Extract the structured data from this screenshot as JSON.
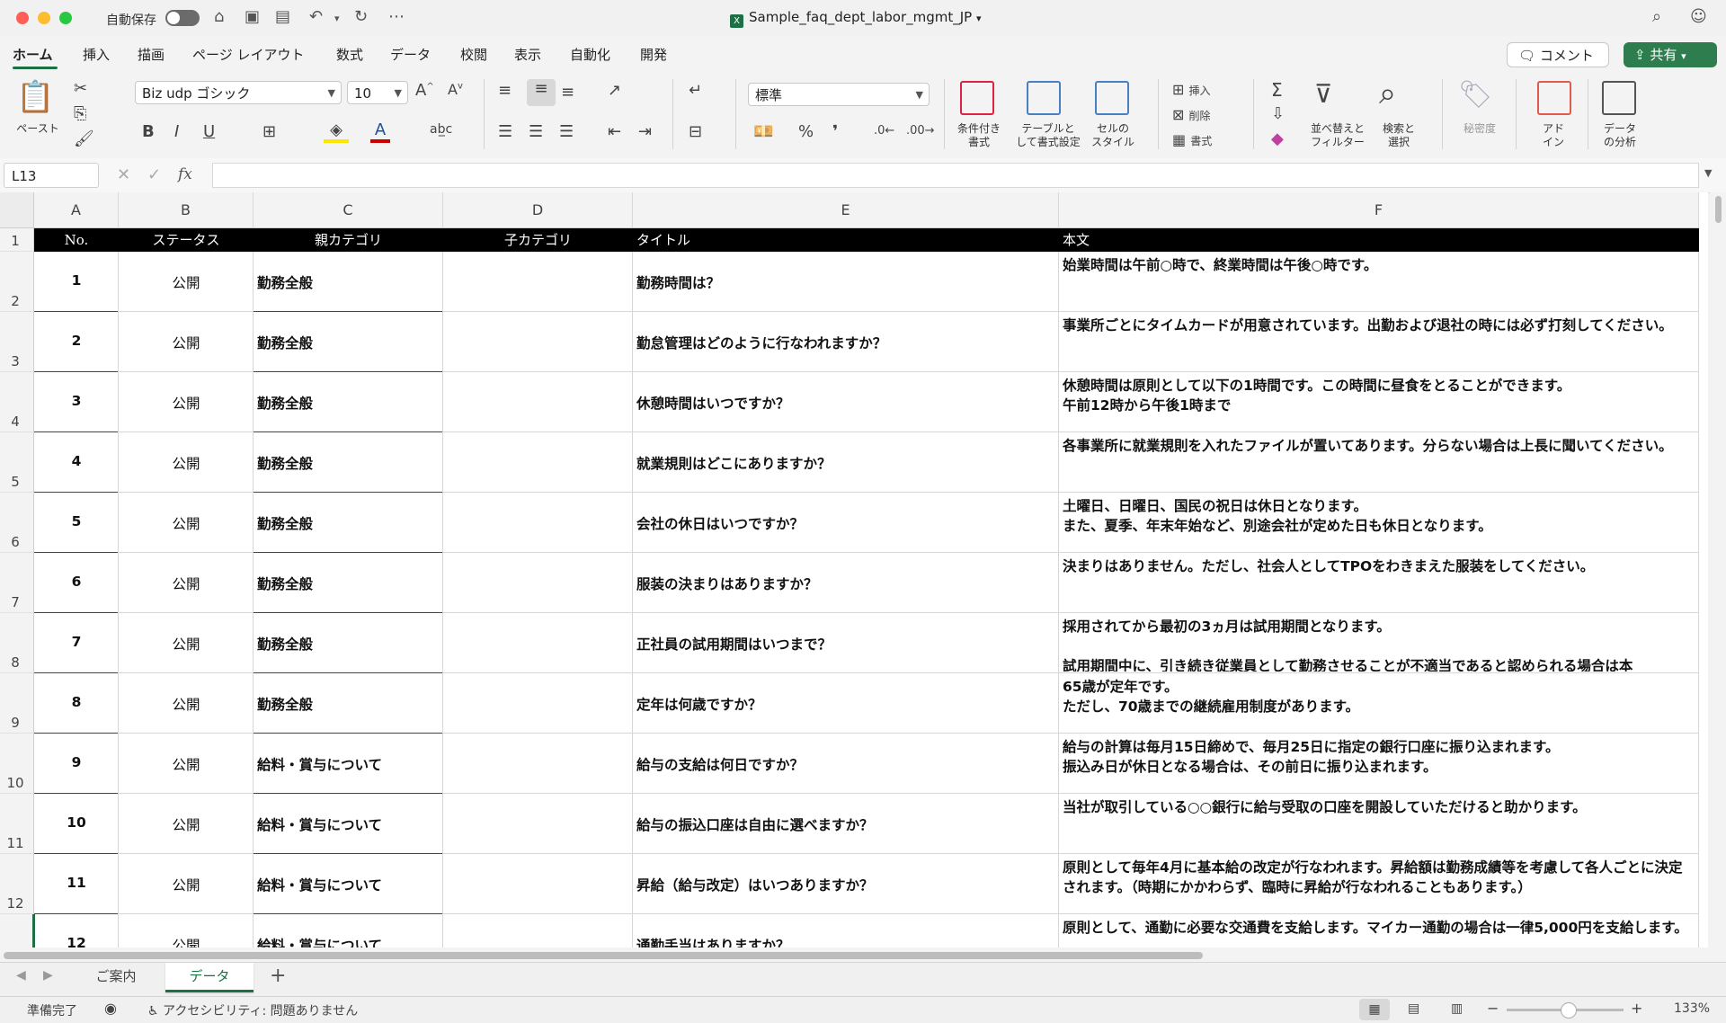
{
  "titlebar": {
    "autosave_label": "自動保存",
    "doc_title": "Sample_faq_dept_labor_mgmt_JP",
    "traffic_colors": [
      "#ff5f57",
      "#febc2e",
      "#28c840"
    ]
  },
  "menu": {
    "tabs": [
      "ホーム",
      "挿入",
      "描画",
      "ページ レイアウト",
      "数式",
      "データ",
      "校閲",
      "表示",
      "自動化",
      "開発"
    ],
    "comment_label": "コメント",
    "share_label": "共有"
  },
  "ribbon": {
    "paste_label": "ペースト",
    "font_name": "Biz udp ゴシック",
    "font_size": "10",
    "number_format": "標準",
    "conditional_format_label": [
      "条件付き",
      "書式"
    ],
    "table_format_label": [
      "テーブルと",
      "して書式設定"
    ],
    "cell_style_label": [
      "セルの",
      "スタイル"
    ],
    "insert_label": "挿入",
    "delete_label": "削除",
    "format_label": "書式",
    "sort_filter_label": [
      "並べ替えと",
      "フィルター"
    ],
    "find_select_label": [
      "検索と",
      "選択"
    ],
    "sensitivity_label": "秘密度",
    "addin_label": [
      "アド",
      "イン"
    ],
    "analyze_label": [
      "データ",
      "の分析"
    ]
  },
  "formula_bar": {
    "name_box": "L13",
    "fx": "fx",
    "value": ""
  },
  "sheet": {
    "columns": [
      "A",
      "B",
      "C",
      "D",
      "E",
      "F"
    ],
    "row_numbers": [
      "1",
      "2",
      "3",
      "4",
      "5",
      "6",
      "7",
      "8",
      "9",
      "10",
      "11",
      "12"
    ],
    "header": [
      "No.",
      "ステータス",
      "親カテゴリ",
      "子カテゴリ",
      "タイトル",
      "本文"
    ],
    "rows": [
      {
        "no": "1",
        "status": "公開",
        "parent": "勤務全般",
        "child": "",
        "title": "勤務時間は？",
        "body": "始業時間は午前○時で、終業時間は午後○時です。"
      },
      {
        "no": "2",
        "status": "公開",
        "parent": "勤務全般",
        "child": "",
        "title": "勤怠管理はどのように行なわれますか？",
        "body": "事業所ごとにタイムカードが用意されています。出勤および退社の時には必ず打刻してください。"
      },
      {
        "no": "3",
        "status": "公開",
        "parent": "勤務全般",
        "child": "",
        "title": "休憩時間はいつですか？",
        "body": "休憩時間は原則として以下の1時間です。この時間に昼食をとることができます。\n午前12時から午後1時まで"
      },
      {
        "no": "4",
        "status": "公開",
        "parent": "勤務全般",
        "child": "",
        "title": "就業規則はどこにありますか？",
        "body": "各事業所に就業規則を入れたファイルが置いてあります。分らない場合は上長に聞いてください。"
      },
      {
        "no": "5",
        "status": "公開",
        "parent": "勤務全般",
        "child": "",
        "title": "会社の休日はいつですか？",
        "body": "土曜日、日曜日、国民の祝日は休日となります。\nまた、夏季、年末年始など、別途会社が定めた日も休日となります。"
      },
      {
        "no": "6",
        "status": "公開",
        "parent": "勤務全般",
        "child": "",
        "title": "服装の決まりはありますか？",
        "body": "決まりはありません。ただし、社会人としてTPOをわきまえた服装をしてください。"
      },
      {
        "no": "7",
        "status": "公開",
        "parent": "勤務全般",
        "child": "",
        "title": "正社員の試用期間はいつまで？",
        "body": "採用されてから最初の3ヵ月は試用期間となります。\n\n試用期間中に、引き続き従業員として勤務させることが不適当であると認められる場合は本"
      },
      {
        "no": "8",
        "status": "公開",
        "parent": "勤務全般",
        "child": "",
        "title": "定年は何歳ですか？",
        "body": "65歳が定年です。\nただし、70歳までの継続雇用制度があります。"
      },
      {
        "no": "9",
        "status": "公開",
        "parent": "給料・賞与について",
        "child": "",
        "title": "給与の支給は何日ですか？",
        "body": "給与の計算は毎月15日締めで、毎月25日に指定の銀行口座に振り込まれます。\n振込み日が休日となる場合は、その前日に振り込まれます。"
      },
      {
        "no": "10",
        "status": "公開",
        "parent": "給料・賞与について",
        "child": "",
        "title": "給与の振込口座は自由に選べますか？",
        "body": "当社が取引している○○銀行に給与受取の口座を開設していただけると助かります。"
      },
      {
        "no": "11",
        "status": "公開",
        "parent": "給料・賞与について",
        "child": "",
        "title": "昇給（給与改定）はいつありますか？",
        "body": "原則として毎年4月に基本給の改定が行なわれます。昇給額は勤務成績等を考慮して各人ごとに決定されます。（時期にかかわらず、臨時に昇給が行なわれることもあります。）"
      },
      {
        "no": "12",
        "status": "公開",
        "parent": "給料・賞与について",
        "child": "",
        "title": "通勤手当はありますか？",
        "body": "原則として、通勤に必要な交通費を支給します。マイカー通勤の場合は一律5,000円を支給します。"
      }
    ]
  },
  "sheet_tabs": [
    "ご案内",
    "データ"
  ],
  "status": {
    "ready": "準備完了",
    "accessibility": "アクセシビリティ: 問題ありません",
    "zoom": "133%"
  }
}
